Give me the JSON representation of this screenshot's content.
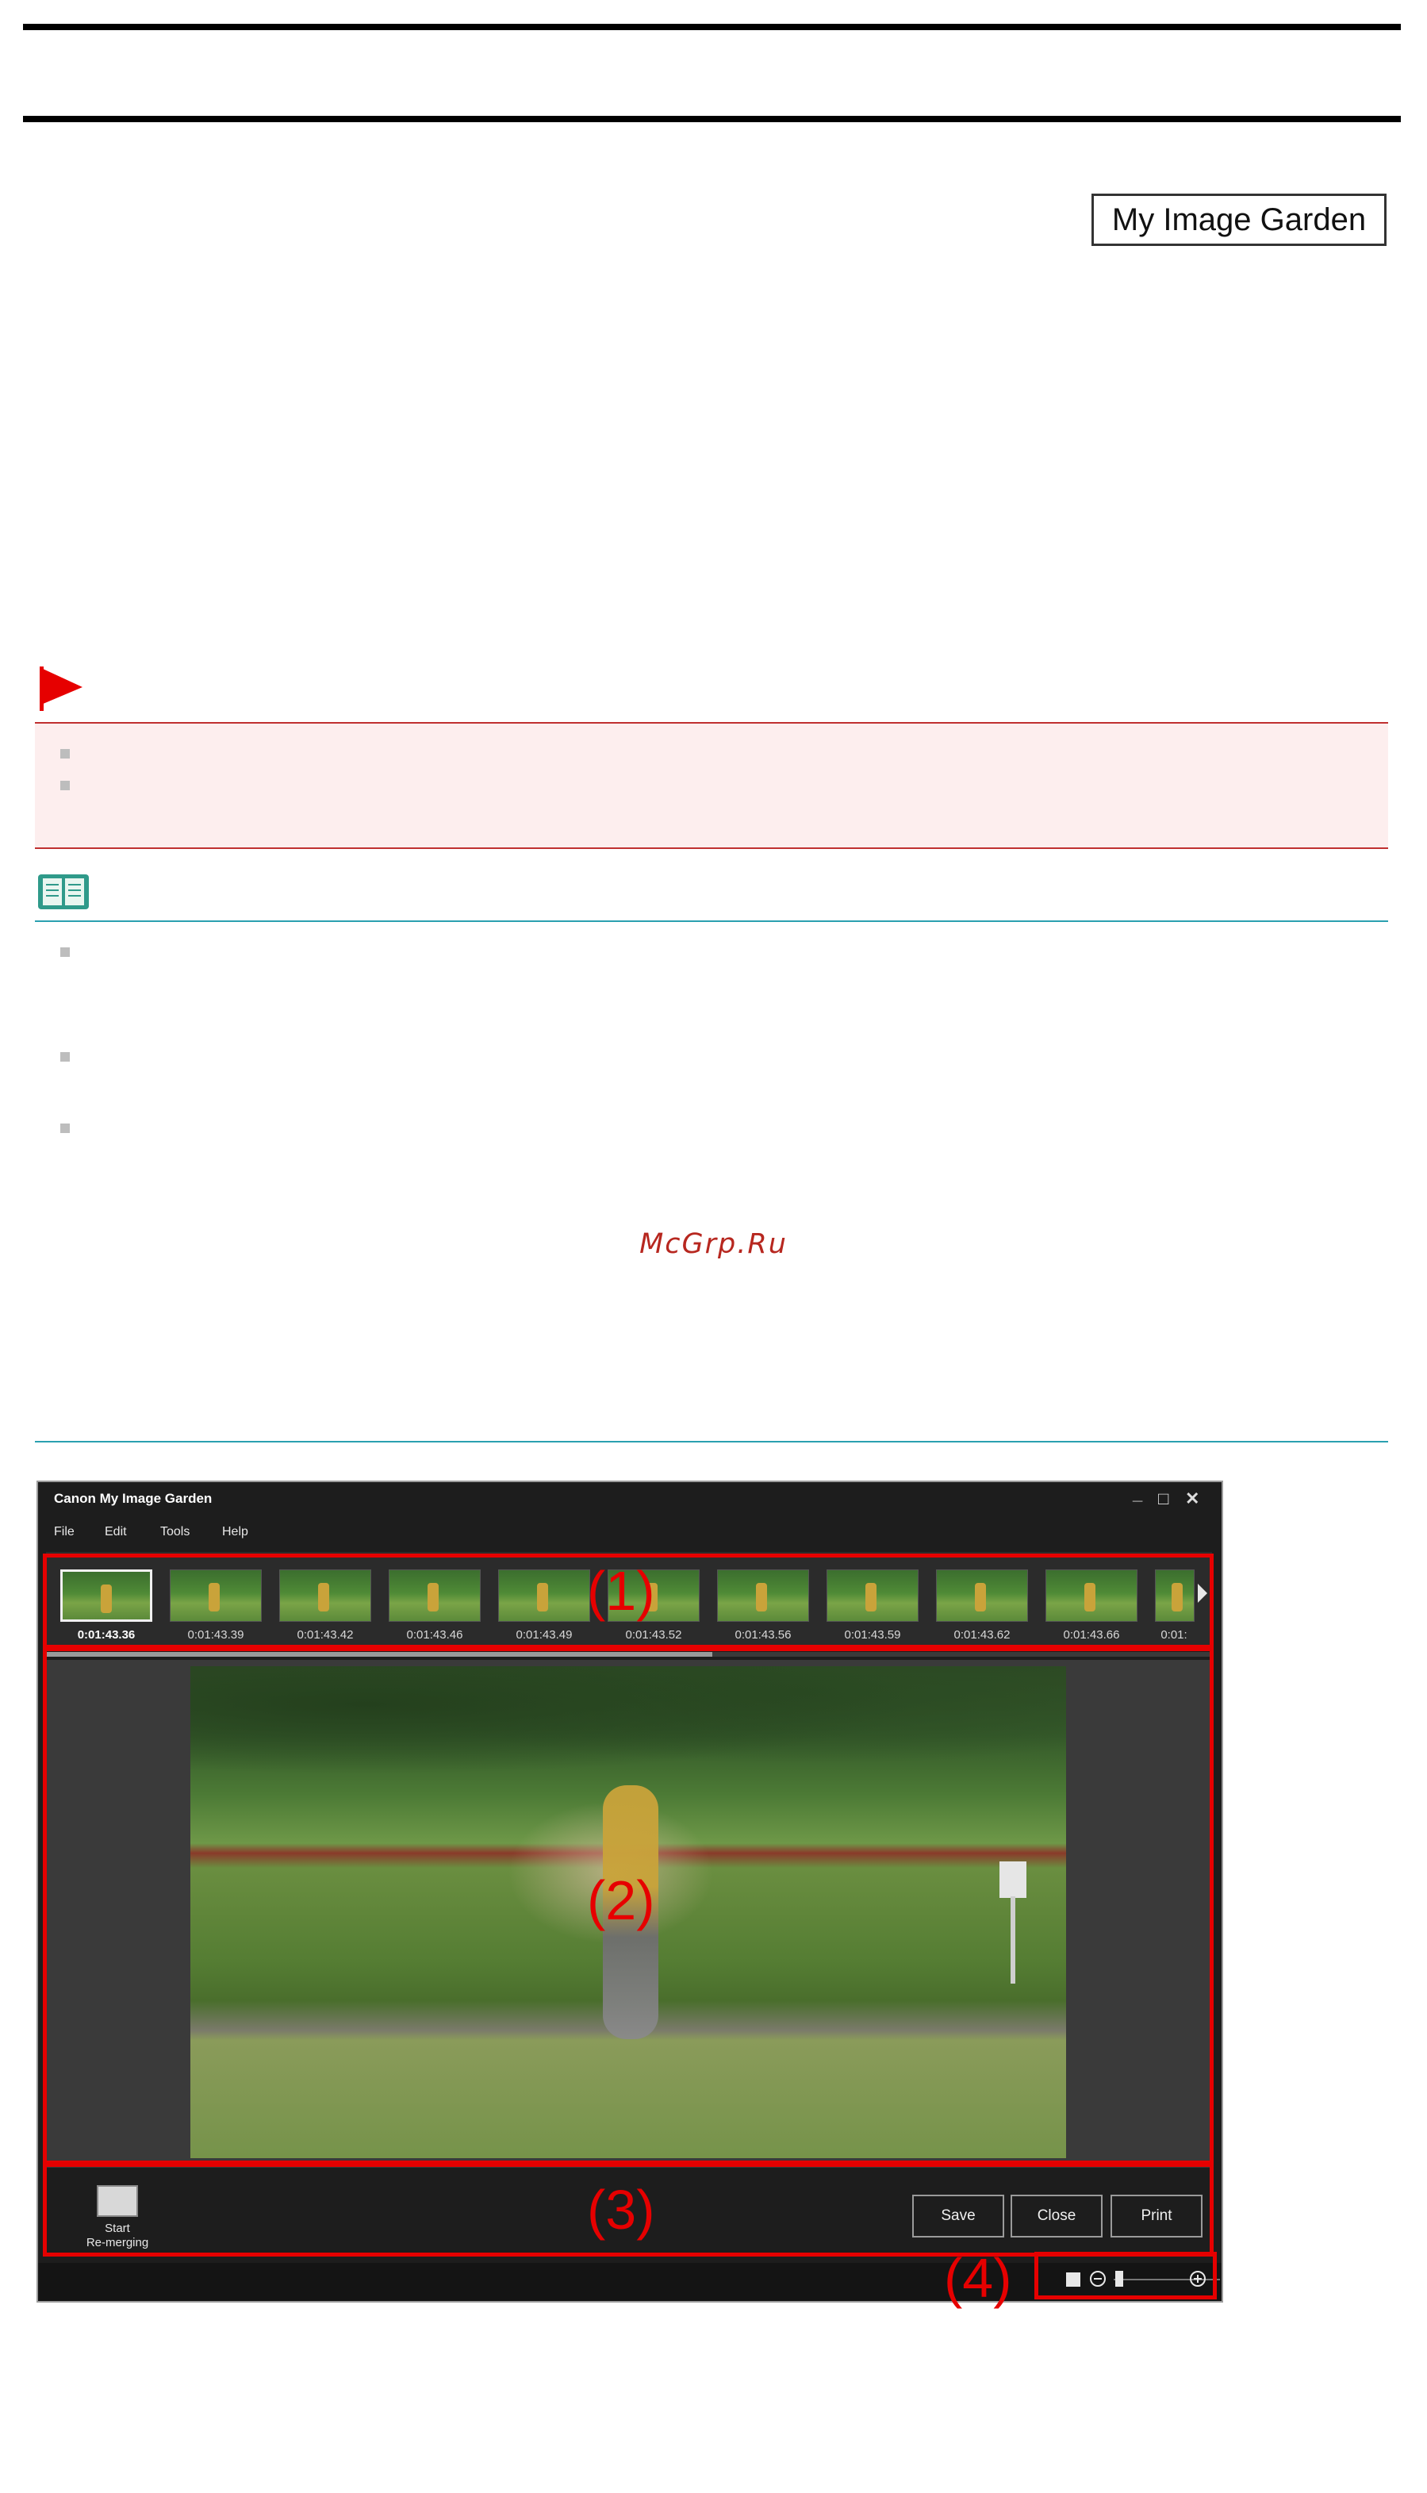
{
  "header": {
    "app_badge": "My Image Garden"
  },
  "watermark": "McGrp.Ru",
  "colors": {
    "important_bg": "#fdeeee",
    "important_line": "#c03030",
    "note_line": "#2aa0b0",
    "callout_red": "#e60000",
    "flag_red": "#e60000"
  },
  "icons": {
    "important": "red-flag-icon",
    "note": "open-book-icon"
  },
  "window": {
    "title": "Canon My Image Garden",
    "controls": [
      "_",
      "□",
      "✕"
    ],
    "menu": [
      "File",
      "Edit",
      "Tools",
      "Help"
    ],
    "thumbnails": [
      {
        "time": "0:01:43.36",
        "selected": true
      },
      {
        "time": "0:01:43.39"
      },
      {
        "time": "0:01:43.42"
      },
      {
        "time": "0:01:43.46"
      },
      {
        "time": "0:01:43.49"
      },
      {
        "time": "0:01:43.52"
      },
      {
        "time": "0:01:43.56"
      },
      {
        "time": "0:01:43.59"
      },
      {
        "time": "0:01:43.62"
      },
      {
        "time": "0:01:43.66"
      },
      {
        "time": "0:01:"
      }
    ],
    "remerge_label_1": "Start",
    "remerge_label_2": "Re-merging",
    "buttons": {
      "save": "Save",
      "close": "Close",
      "print": "Print"
    }
  },
  "callouts": {
    "c1": "(1)",
    "c2": "(2)",
    "c3": "(3)",
    "c4": "(4)"
  }
}
